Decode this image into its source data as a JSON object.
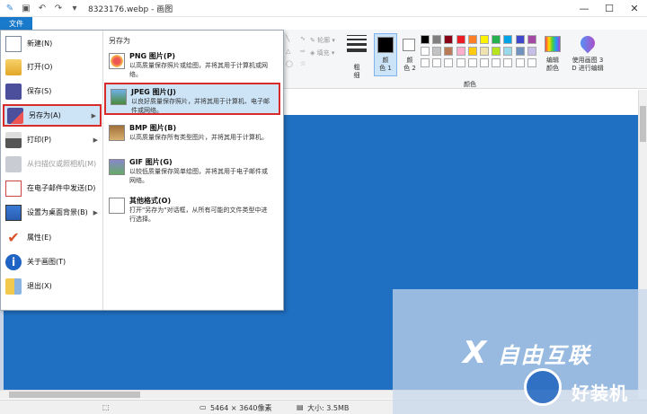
{
  "titlebar": {
    "title": "8323176.webp - 画图",
    "minimize": "—",
    "maximize": "☐",
    "close": "✕"
  },
  "ribbon": {
    "file_tab": "文件",
    "shapes_outline": "轮廓",
    "shapes_fill": "填充",
    "size_label": "粗\n细",
    "color1_label": "颜\n色 1",
    "color2_label": "颜\n色 2",
    "edit_colors_label": "编辑\n颜色",
    "paint3d_label": "使用画图 3\nD 进行编辑",
    "colors_group": "颜色",
    "palette_row1": [
      "#000000",
      "#7f7f7f",
      "#880015",
      "#ed1c24",
      "#ff7f27",
      "#fff200",
      "#22b14c",
      "#00a2e8",
      "#3f48cc",
      "#a349a4"
    ],
    "palette_row2": [
      "#ffffff",
      "#c3c3c3",
      "#b97a57",
      "#ffaec9",
      "#ffc90e",
      "#efe4b0",
      "#b5e61d",
      "#99d9ea",
      "#7092be",
      "#c8bfe7"
    ],
    "color1": "#000000",
    "color2": "#ffffff"
  },
  "filemenu": {
    "items": [
      {
        "label": "新建(N)",
        "icon": "new-file-icon"
      },
      {
        "label": "打开(O)",
        "icon": "open-folder-icon"
      },
      {
        "label": "保存(S)",
        "icon": "save-icon"
      },
      {
        "label": "另存为(A)",
        "icon": "save-as-icon",
        "arrow": "▶"
      },
      {
        "label": "打印(P)",
        "icon": "printer-icon",
        "arrow": "▶"
      },
      {
        "label": "从扫描仪或照相机(M)",
        "icon": "scanner-icon"
      },
      {
        "label": "在电子邮件中发送(D)",
        "icon": "email-icon"
      },
      {
        "label": "设置为桌面背景(B)",
        "icon": "desktop-icon",
        "arrow": "▶"
      },
      {
        "label": "属性(E)",
        "icon": "checkmark-icon"
      },
      {
        "label": "关于画图(T)",
        "icon": "info-icon"
      },
      {
        "label": "退出(X)",
        "icon": "exit-icon"
      }
    ],
    "submenu_title": "另存为",
    "submenu": [
      {
        "title": "PNG 图片(P)",
        "desc": "以高质量保存照片或绘图，并将其用于计算机或网络。",
        "icon": "png-icon"
      },
      {
        "title": "JPEG 图片(J)",
        "desc": "以良好质量保存照片，并将其用于计算机、电子邮件或网络。",
        "icon": "jpeg-icon"
      },
      {
        "title": "BMP 图片(B)",
        "desc": "以高质量保存所有类型图片，并将其用于计算机。",
        "icon": "bmp-icon"
      },
      {
        "title": "GIF 图片(G)",
        "desc": "以较低质量保存简单绘图，并将其用于电子邮件或网络。",
        "icon": "gif-icon"
      },
      {
        "title": "其他格式(O)",
        "desc": "打开\"另存为\"对话框，从所有可能的文件类型中进行选择。",
        "icon": "other-format-icon"
      }
    ]
  },
  "statusbar": {
    "dimensions": "5464 × 3640像素",
    "size": "大小: 3.5MB"
  },
  "watermark": {
    "text": "自由互联",
    "text2": "好装机"
  }
}
